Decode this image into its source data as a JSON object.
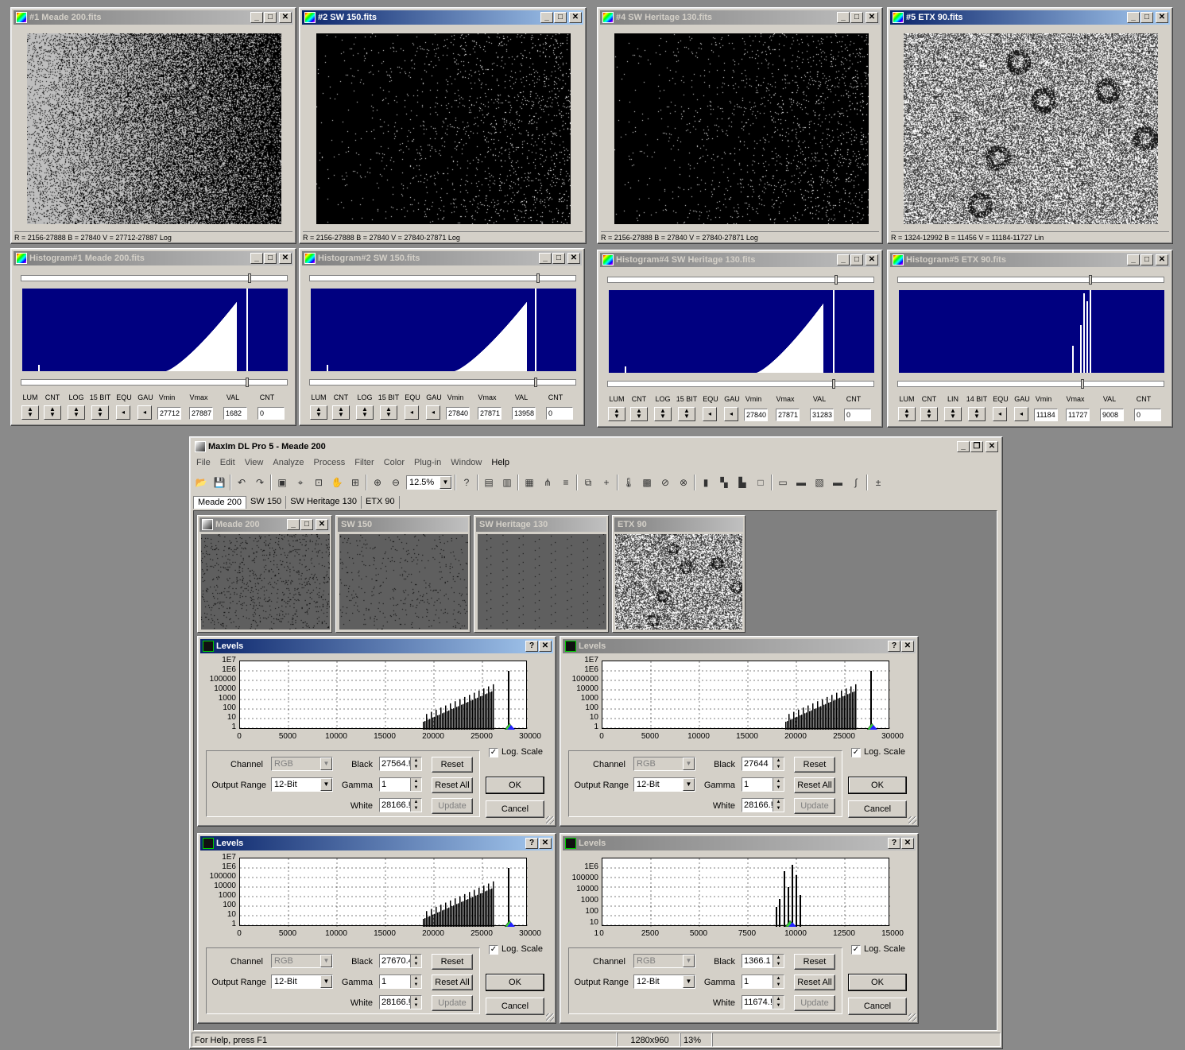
{
  "image_windows": [
    {
      "title": "#1 Meade 200.fits",
      "status": "R = 2156-27888   B = 27840   V = 27712-27887 Log",
      "active": false,
      "style": "grey"
    },
    {
      "title": "#2 SW 150.fits",
      "status": "R = 2156-27888   B = 27840   V = 27840-27871 Log",
      "active": true,
      "style": "black"
    },
    {
      "title": "#4 SW Heritage 130.fits",
      "status": "R = 2156-27888   B = 27840   V = 27840-27871 Log",
      "active": false,
      "style": "black"
    },
    {
      "title": "#5 ETX 90.fits",
      "status": "R = 1324-12992   B = 11456   V = 11184-11727 Lin",
      "active": true,
      "style": "noise"
    }
  ],
  "hist_windows": [
    {
      "title": "Histogram#1 Meade 200.fits",
      "labels": [
        "LUM",
        "CNT",
        "LOG",
        "15 BIT",
        "EQU",
        "GAU",
        "Vmin",
        "Vmax",
        "VAL",
        "CNT"
      ],
      "vmin": "27712",
      "vmax": "27887",
      "val": "1682",
      "cnt": "0"
    },
    {
      "title": "Histogram#2 SW 150.fits",
      "labels": [
        "LUM",
        "CNT",
        "LOG",
        "15 BIT",
        "EQU",
        "GAU",
        "Vmin",
        "Vmax",
        "VAL",
        "CNT"
      ],
      "vmin": "27840",
      "vmax": "27871",
      "val": "13958",
      "cnt": "0"
    },
    {
      "title": "Histogram#4 SW Heritage 130.fits",
      "labels": [
        "LUM",
        "CNT",
        "LOG",
        "15 BIT",
        "EQU",
        "GAU",
        "Vmin",
        "Vmax",
        "VAL",
        "CNT"
      ],
      "vmin": "27840",
      "vmax": "27871",
      "val": "31283",
      "cnt": "0"
    },
    {
      "title": "Histogram#5 ETX 90.fits",
      "labels": [
        "LUM",
        "CNT",
        "LIN",
        "14 BIT",
        "EQU",
        "GAU",
        "Vmin",
        "Vmax",
        "VAL",
        "CNT"
      ],
      "vmin": "11184",
      "vmax": "11727",
      "val": "9008",
      "cnt": "0"
    }
  ],
  "app": {
    "title": "MaxIm DL Pro 5 - Meade 200",
    "menu": [
      "File",
      "Edit",
      "View",
      "Analyze",
      "Process",
      "Filter",
      "Color",
      "Plug-in",
      "Window",
      "Help"
    ],
    "zoom": "12.5%",
    "tabs": [
      "Meade 200",
      "SW 150",
      "SW Heritage 130",
      "ETX 90"
    ],
    "status_help": "For Help, press F1",
    "status_size": "1280x960",
    "status_zoom": "13%"
  },
  "thumbs": [
    {
      "title": "Meade 200",
      "active": true
    },
    {
      "title": "SW 150",
      "active": false
    },
    {
      "title": "SW Heritage 130",
      "active": false
    },
    {
      "title": "ETX 90",
      "active": false
    }
  ],
  "levels": [
    {
      "title": "Levels",
      "active": true,
      "ylabels": [
        "1E7",
        "1E6",
        "100000",
        "10000",
        "1000",
        "100",
        "10",
        "1"
      ],
      "xlabels": [
        "0",
        "5000",
        "10000",
        "15000",
        "20000",
        "25000",
        "30000"
      ],
      "channel_label": "Channel",
      "channel": "RGB",
      "output_label": "Output Range",
      "output": "12-Bit",
      "black_label": "Black",
      "black": "27564.!",
      "gamma_label": "Gamma",
      "gamma": "1",
      "white_label": "White",
      "white": "28166.!",
      "log_label": "Log. Scale",
      "reset": "Reset",
      "reset_all": "Reset All",
      "update": "Update",
      "ok": "OK",
      "cancel": "Cancel"
    },
    {
      "title": "Levels",
      "active": false,
      "ylabels": [
        "1E7",
        "1E6",
        "100000",
        "10000",
        "1000",
        "100",
        "10",
        "1"
      ],
      "xlabels": [
        "0",
        "5000",
        "10000",
        "15000",
        "20000",
        "25000",
        "30000"
      ],
      "channel_label": "Channel",
      "channel": "RGB",
      "output_label": "Output Range",
      "output": "12-Bit",
      "black_label": "Black",
      "black": "27644",
      "gamma_label": "Gamma",
      "gamma": "1",
      "white_label": "White",
      "white": "28166.!",
      "log_label": "Log. Scale",
      "reset": "Reset",
      "reset_all": "Reset All",
      "update": "Update",
      "ok": "OK",
      "cancel": "Cancel"
    },
    {
      "title": "Levels",
      "active": true,
      "ylabels": [
        "1E7",
        "1E6",
        "100000",
        "10000",
        "1000",
        "100",
        "10",
        "1"
      ],
      "xlabels": [
        "0",
        "5000",
        "10000",
        "15000",
        "20000",
        "25000",
        "30000"
      ],
      "channel_label": "Channel",
      "channel": "RGB",
      "output_label": "Output Range",
      "output": "12-Bit",
      "black_label": "Black",
      "black": "27670.4",
      "gamma_label": "Gamma",
      "gamma": "1",
      "white_label": "White",
      "white": "28166.!",
      "log_label": "Log. Scale",
      "reset": "Reset",
      "reset_all": "Reset All",
      "update": "Update",
      "ok": "OK",
      "cancel": "Cancel"
    },
    {
      "title": "Levels",
      "active": false,
      "ylabels": [
        "1E6",
        "100000",
        "10000",
        "1000",
        "100",
        "10",
        "1"
      ],
      "xlabels": [
        "0",
        "2500",
        "5000",
        "7500",
        "10000",
        "12500",
        "15000"
      ],
      "channel_label": "Channel",
      "channel": "RGB",
      "output_label": "Output Range",
      "output": "12-Bit",
      "black_label": "Black",
      "black": "1366.1",
      "gamma_label": "Gamma",
      "gamma": "1",
      "white_label": "White",
      "white": "11674.!",
      "log_label": "Log. Scale",
      "reset": "Reset",
      "reset_all": "Reset All",
      "update": "Update",
      "ok": "OK",
      "cancel": "Cancel"
    }
  ]
}
